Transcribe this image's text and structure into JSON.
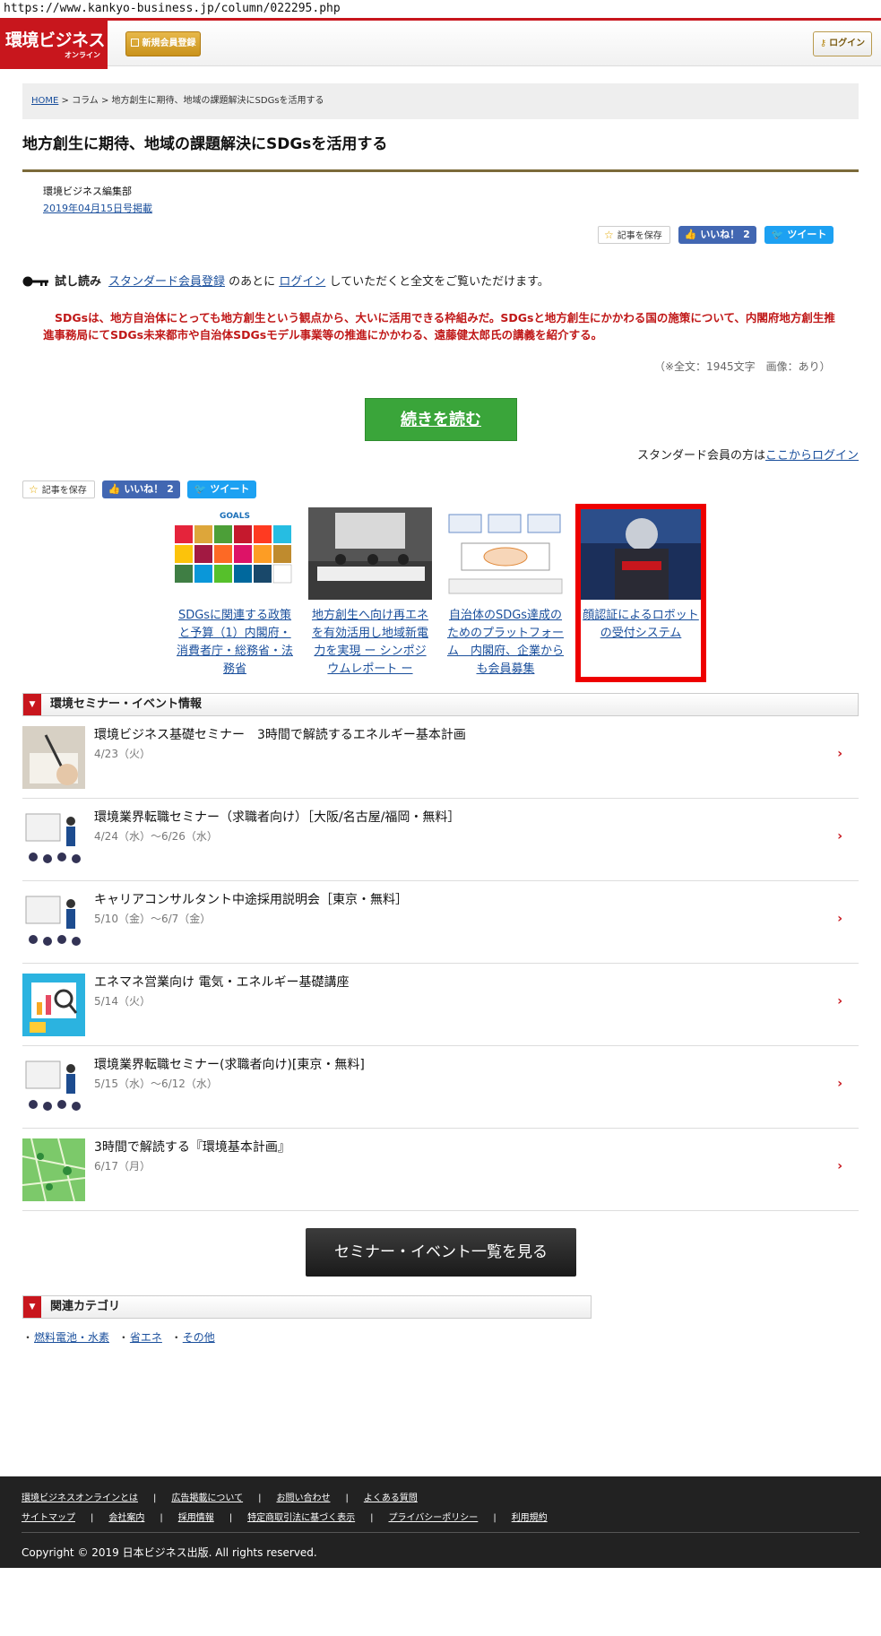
{
  "url": "https://www.kankyo-business.jp/column/022295.php",
  "header": {
    "logo_main": "環境ビジネス",
    "logo_sub": "オンライン",
    "register": "新規会員登録",
    "login": "ログイン"
  },
  "breadcrumb": {
    "home": "HOME",
    "column": "コラム",
    "current": "地方創生に期待、地域の課題解決にSDGsを活用する"
  },
  "article": {
    "title": "地方創生に期待、地域の課題解決にSDGsを活用する",
    "author": "環境ビジネス編集部",
    "date": "2019年04月15日号掲載",
    "save": "記事を保存",
    "like": "いいね！ 2",
    "tweet": "ツイート",
    "trial_label": "試し読み",
    "trial_link1": "スタンダード会員登録",
    "trial_mid1": "のあとに",
    "trial_link2": "ログイン",
    "trial_end": "していただくと全文をご覧いただけます。",
    "lead": "SDGsは、地方自治体にとっても地方創生という観点から、大いに活用できる枠組みだ。SDGsと地方創生にかかわる国の施策について、内閣府地方創生推進事務局にてSDGs未来都市や自治体SDGsモデル事業等の推進にかかわる、遠藤健太郎氏の講義を紹介する。",
    "meta": "（※全文：1945文字　画像：あり）",
    "continue": "続きを読む",
    "std_prefix": "スタンダード会員の方は",
    "std_link": "ここからログイン"
  },
  "related": [
    {
      "caption": "SDGsに関連する政策と予算（1）内閣府・消費者庁・総務省・法務省"
    },
    {
      "caption": "地方創生へ向け再エネを有効活用し地域新電力を実現 ー シンポジウムレポート ー"
    },
    {
      "caption": "自治体のSDGs達成のためのプラットフォーム　内閣府、企業からも会員募集"
    },
    {
      "caption": "顔認証によるロボットの受付システム"
    }
  ],
  "seminar": {
    "heading": "環境セミナー・イベント情報",
    "items": [
      {
        "title": "環境ビジネス基礎セミナー　3時間で解読するエネルギー基本計画",
        "date": "4/23（火）"
      },
      {
        "title": "環境業界転職セミナー（求職者向け）［大阪/名古屋/福岡・無料］",
        "date": "4/24（水）～6/26（水）"
      },
      {
        "title": "キャリアコンサルタント中途採用説明会［東京・無料］",
        "date": "5/10（金）～6/7（金）"
      },
      {
        "title": "エネマネ営業向け 電気・エネルギー基礎講座",
        "date": "5/14（火）"
      },
      {
        "title": "環境業界転職セミナー(求職者向け)[東京・無料]",
        "date": "5/15（水）～6/12（水）"
      },
      {
        "title": "3時間で解読する『環境基本計画』",
        "date": "6/17（月）"
      }
    ],
    "button": "セミナー・イベント一覧を見る"
  },
  "categories": {
    "heading": "関連カテゴリ",
    "items": [
      "燃料電池・水素",
      "省エネ",
      "その他"
    ]
  },
  "footer": {
    "row1": [
      "環境ビジネスオンラインとは",
      "広告掲載について",
      "お問い合わせ",
      "よくある質問"
    ],
    "row2": [
      "サイトマップ",
      "会社案内",
      "採用情報",
      "特定商取引法に基づく表示",
      "プライバシーポリシー",
      "利用規約"
    ],
    "copyright": "Copyright © 2019 日本ビジネス出版. All rights reserved."
  },
  "colors": {
    "brand": "#c8161d",
    "link": "#1a4f9c",
    "continue": "#3aa53a"
  }
}
